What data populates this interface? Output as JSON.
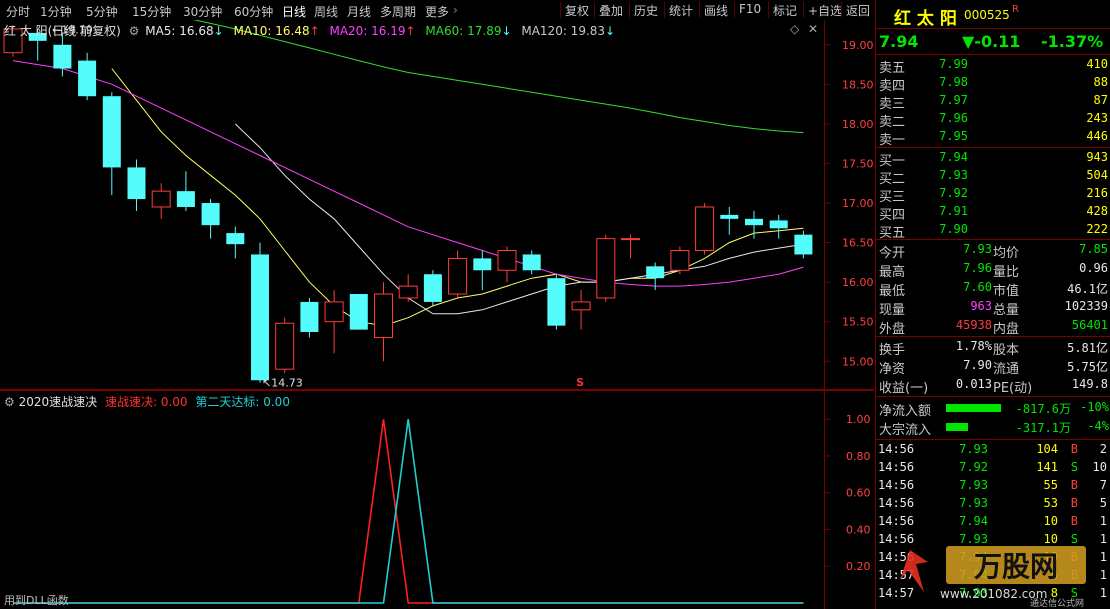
{
  "toolbar": {
    "periods": [
      "分时",
      "1分钟",
      "5分钟",
      "15分钟",
      "30分钟",
      "60分钟",
      "日线",
      "周线",
      "月线",
      "多周期",
      "更多"
    ],
    "active_period": "日线",
    "right_buttons": [
      "复权",
      "叠加",
      "历史",
      "统计",
      "画线",
      "F10",
      "标记",
      "+自选",
      "返回"
    ]
  },
  "chart_header": {
    "title": "红 太 阳(日线 前复权)",
    "ma5": "MA5: 16.68",
    "ma10": "MA10: 16.48",
    "ma20": "MA20: 16.19",
    "ma60": "MA60: 17.89",
    "ma120": "MA120: 19.83"
  },
  "chart_data": [
    {
      "type": "candlestick",
      "title": "红 太 阳(日线 前复权)",
      "ylim": [
        14.7,
        19.25
      ],
      "y_ticks": [
        "19.00",
        "18.50",
        "18.00",
        "17.50",
        "17.00",
        "16.50",
        "16.00",
        "15.50",
        "15.00"
      ],
      "annotations": {
        "high_label": "19.19",
        "low_label": "14.73",
        "marker": "S"
      },
      "candles": [
        {
          "o": 18.9,
          "c": 19.2,
          "h": 19.25,
          "l": 18.85
        },
        {
          "o": 19.15,
          "c": 19.05,
          "h": 19.2,
          "l": 18.8
        },
        {
          "o": 19.0,
          "c": 18.7,
          "h": 19.15,
          "l": 18.6
        },
        {
          "o": 18.8,
          "c": 18.35,
          "h": 18.9,
          "l": 18.3
        },
        {
          "o": 18.35,
          "c": 17.45,
          "h": 18.4,
          "l": 17.1
        },
        {
          "o": 17.45,
          "c": 17.05,
          "h": 17.55,
          "l": 16.9
        },
        {
          "o": 16.95,
          "c": 17.15,
          "h": 17.25,
          "l": 16.8
        },
        {
          "o": 17.15,
          "c": 16.95,
          "h": 17.4,
          "l": 16.9
        },
        {
          "o": 17.0,
          "c": 16.72,
          "h": 17.05,
          "l": 16.55
        },
        {
          "o": 16.62,
          "c": 16.48,
          "h": 16.7,
          "l": 16.3
        },
        {
          "o": 16.35,
          "c": 14.76,
          "h": 16.5,
          "l": 14.73
        },
        {
          "o": 14.9,
          "c": 15.48,
          "h": 15.55,
          "l": 14.85
        },
        {
          "o": 15.75,
          "c": 15.37,
          "h": 15.8,
          "l": 15.3
        },
        {
          "o": 15.5,
          "c": 15.75,
          "h": 15.9,
          "l": 15.1
        },
        {
          "o": 15.85,
          "c": 15.4,
          "h": 15.85,
          "l": 15.4
        },
        {
          "o": 15.3,
          "c": 15.85,
          "h": 16.0,
          "l": 15.0
        },
        {
          "o": 15.8,
          "c": 15.95,
          "h": 16.1,
          "l": 15.75
        },
        {
          "o": 16.1,
          "c": 15.75,
          "h": 16.15,
          "l": 15.7
        },
        {
          "o": 15.85,
          "c": 16.3,
          "h": 16.4,
          "l": 15.8
        },
        {
          "o": 16.3,
          "c": 16.15,
          "h": 16.4,
          "l": 15.9
        },
        {
          "o": 16.15,
          "c": 16.4,
          "h": 16.45,
          "l": 16.0
        },
        {
          "o": 16.35,
          "c": 16.15,
          "h": 16.4,
          "l": 16.1
        },
        {
          "o": 16.05,
          "c": 15.45,
          "h": 16.1,
          "l": 15.4
        },
        {
          "o": 15.65,
          "c": 15.75,
          "h": 15.9,
          "l": 15.4
        },
        {
          "o": 15.8,
          "c": 16.55,
          "h": 16.6,
          "l": 15.75
        },
        {
          "o": 16.55,
          "c": 16.55,
          "h": 16.6,
          "l": 16.3
        },
        {
          "o": 16.2,
          "c": 16.05,
          "h": 16.25,
          "l": 15.9
        },
        {
          "o": 16.15,
          "c": 16.4,
          "h": 16.45,
          "l": 16.1
        },
        {
          "o": 16.4,
          "c": 16.95,
          "h": 17.0,
          "l": 16.35
        },
        {
          "o": 16.85,
          "c": 16.8,
          "h": 16.95,
          "l": 16.6
        },
        {
          "o": 16.8,
          "c": 16.72,
          "h": 16.9,
          "l": 16.55
        },
        {
          "o": 16.78,
          "c": 16.68,
          "h": 16.85,
          "l": 16.55
        },
        {
          "o": 16.6,
          "c": 16.35,
          "h": 16.65,
          "l": 16.3
        }
      ],
      "ma_lines": [
        {
          "name": "MA5",
          "color": "#ffff66",
          "values": [
            null,
            null,
            null,
            null,
            18.7,
            18.3,
            17.9,
            17.6,
            17.35,
            17.1,
            16.8,
            16.4,
            16.0,
            15.7,
            15.5,
            15.45,
            15.55,
            15.7,
            15.8,
            15.85,
            15.95,
            16.05,
            16.1,
            16.0,
            16.0,
            16.05,
            16.05,
            16.15,
            16.3,
            16.5,
            16.62,
            16.65,
            16.68
          ]
        },
        {
          "name": "MA10",
          "color": "#e8e8e8",
          "values": [
            null,
            null,
            null,
            null,
            null,
            null,
            null,
            null,
            null,
            18.0,
            17.7,
            17.35,
            17.05,
            16.8,
            16.45,
            16.1,
            15.8,
            15.6,
            15.6,
            15.65,
            15.75,
            15.85,
            15.95,
            16.0,
            16.0,
            16.05,
            16.1,
            16.15,
            16.2,
            16.3,
            16.38,
            16.43,
            16.48
          ]
        },
        {
          "name": "MA20",
          "color": "#ff40ff",
          "values": [
            18.8,
            18.75,
            18.7,
            18.6,
            18.5,
            18.35,
            18.2,
            18.05,
            17.9,
            17.75,
            17.6,
            17.45,
            17.3,
            17.15,
            17.0,
            16.85,
            16.7,
            16.6,
            16.5,
            16.4,
            16.3,
            16.2,
            16.1,
            16.05,
            16.0,
            15.97,
            15.95,
            15.95,
            15.97,
            16.0,
            16.05,
            16.1,
            16.19
          ]
        },
        {
          "name": "MA60",
          "color": "#33dd33",
          "values": [
            19.9,
            19.82,
            19.74,
            19.66,
            19.58,
            19.5,
            19.42,
            19.34,
            19.27,
            19.2,
            19.12,
            19.04,
            18.96,
            18.88,
            18.8,
            18.72,
            18.65,
            18.6,
            18.55,
            18.5,
            18.45,
            18.4,
            18.35,
            18.3,
            18.25,
            18.2,
            18.14,
            18.08,
            18.03,
            17.98,
            17.94,
            17.91,
            17.89
          ]
        }
      ]
    },
    {
      "type": "line",
      "title": "2020速战速决",
      "ylim": [
        0,
        1.05
      ],
      "y_ticks": [
        "1.00",
        "0.80",
        "0.60",
        "0.40",
        "0.20"
      ],
      "x": [
        0,
        1,
        2,
        3,
        4,
        5,
        6,
        7,
        8,
        9,
        10,
        11,
        12,
        13,
        14,
        15,
        16,
        17,
        18,
        19,
        20,
        21,
        22,
        23,
        24,
        25,
        26,
        27,
        28,
        29,
        30,
        31,
        32
      ],
      "series": [
        {
          "name": "速战速决",
          "color": "#ff2020",
          "values": [
            0,
            0,
            0,
            0,
            0,
            0,
            0,
            0,
            0,
            0,
            0,
            0,
            0,
            0,
            0,
            1,
            0,
            0,
            0,
            0,
            0,
            0,
            0,
            0,
            0,
            0,
            0,
            0,
            0,
            0,
            0,
            0,
            0
          ]
        },
        {
          "name": "第二天达标",
          "color": "#20d0d0",
          "values": [
            0,
            0,
            0,
            0,
            0,
            0,
            0,
            0,
            0,
            0,
            0,
            0,
            0,
            0,
            0,
            0,
            1,
            0,
            0,
            0,
            0,
            0,
            0,
            0,
            0,
            0,
            0,
            0,
            0,
            0,
            0,
            0,
            0
          ]
        }
      ]
    }
  ],
  "indicator_header": {
    "name": "2020速战速决",
    "s1": "速战速决: 0.00",
    "s2": "第二天达标: 0.00"
  },
  "footer_text": "用到DLL函数",
  "stock": {
    "name": "红 太 阳",
    "code": "000525",
    "flag": "R",
    "price": "7.94",
    "change": "▼-0.11",
    "pct": "-1.37%"
  },
  "order_book": {
    "sells": [
      {
        "label": "卖五",
        "price": "7.99",
        "vol": "410"
      },
      {
        "label": "卖四",
        "price": "7.98",
        "vol": "88"
      },
      {
        "label": "卖三",
        "price": "7.97",
        "vol": "87"
      },
      {
        "label": "卖二",
        "price": "7.96",
        "vol": "243"
      },
      {
        "label": "卖一",
        "price": "7.95",
        "vol": "446"
      }
    ],
    "buys": [
      {
        "label": "买一",
        "price": "7.94",
        "vol": "943"
      },
      {
        "label": "买二",
        "price": "7.93",
        "vol": "504"
      },
      {
        "label": "买三",
        "price": "7.92",
        "vol": "216"
      },
      {
        "label": "买四",
        "price": "7.91",
        "vol": "428"
      },
      {
        "label": "买五",
        "price": "7.90",
        "vol": "222"
      }
    ]
  },
  "stats": [
    {
      "l1": "今开",
      "v1": "7.93",
      "l2": "均价",
      "v2": "7.85"
    },
    {
      "l1": "最高",
      "v1": "7.96",
      "l2": "量比",
      "v2": "0.96"
    },
    {
      "l1": "最低",
      "v1": "7.60",
      "l2": "市值",
      "v2": "46.1亿"
    },
    {
      "l1": "现量",
      "v1": "963",
      "l2": "总量",
      "v2": "102339"
    },
    {
      "l1": "外盘",
      "v1": "45938",
      "l2": "内盘",
      "v2": "56401"
    }
  ],
  "stats2": [
    {
      "l1": "换手",
      "v1": "1.78%",
      "l2": "股本",
      "v2": "5.81亿"
    },
    {
      "l1": "净资",
      "v1": "7.90",
      "l2": "流通",
      "v2": "5.75亿"
    },
    {
      "l1": "收益(一)",
      "v1": "0.013",
      "l2": "PE(动)",
      "v2": "149.8"
    }
  ],
  "flows": [
    {
      "label": "净流入额",
      "amount": "-817.6万",
      "pct": "-10%",
      "bar": 0.55
    },
    {
      "label": "大宗流入",
      "amount": "-317.1万",
      "pct": "-4%",
      "bar": 0.22
    }
  ],
  "ticks": [
    {
      "time": "14:56",
      "price": "7.93",
      "vol": "104",
      "side": "B",
      "n": "2"
    },
    {
      "time": "14:56",
      "price": "7.92",
      "vol": "141",
      "side": "S",
      "n": "10"
    },
    {
      "time": "14:56",
      "price": "7.93",
      "vol": "55",
      "side": "B",
      "n": "7"
    },
    {
      "time": "14:56",
      "price": "7.93",
      "vol": "53",
      "side": "B",
      "n": "5"
    },
    {
      "time": "14:56",
      "price": "7.94",
      "vol": "10",
      "side": "B",
      "n": "1"
    },
    {
      "time": "14:56",
      "price": "7.93",
      "vol": "10",
      "side": "S",
      "n": "1"
    },
    {
      "time": "14:56",
      "price": "7.94",
      "vol": "10",
      "side": "B",
      "n": "1"
    },
    {
      "time": "14:57",
      "price": "7.94",
      "vol": "5",
      "side": "B",
      "n": "1"
    },
    {
      "time": "14:57",
      "price": "7.93",
      "vol": "8",
      "side": "S",
      "n": "1"
    }
  ],
  "watermark": {
    "brand": "万股网",
    "url": "www.201082.com",
    "sub": "通达信公式网"
  },
  "colors": {
    "up": "#ff3c3c",
    "down": "#54fcfc",
    "border": "#7a0000"
  }
}
